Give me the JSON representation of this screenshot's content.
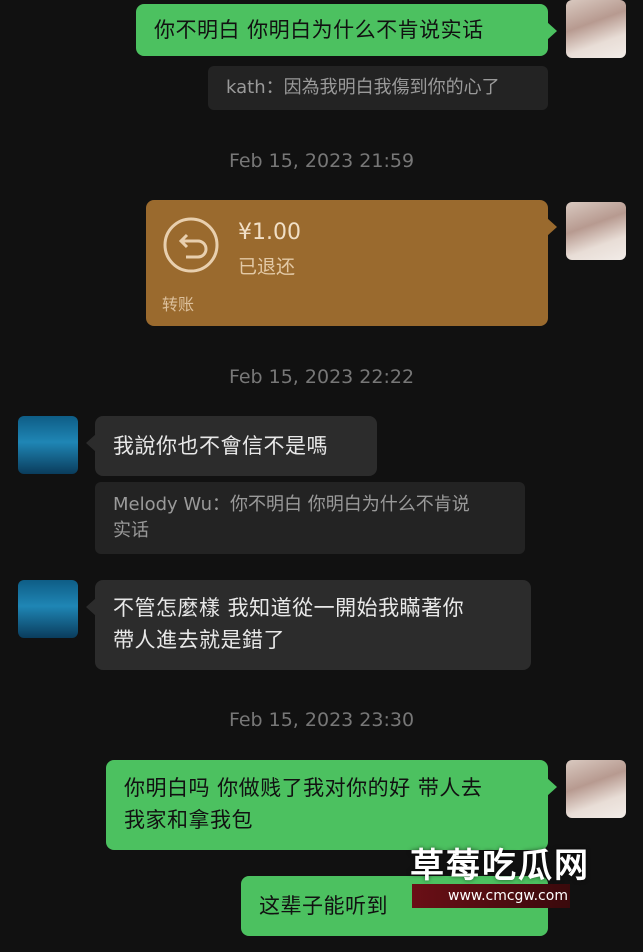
{
  "messages": {
    "m1": "你不明白 你明白为什么不肯说实话",
    "q1": "kath：因為我明白我傷到你的心了",
    "t1": "Feb 15, 2023 21:59",
    "transfer": {
      "amount": "¥1.00",
      "status": "已退还",
      "label": "转账"
    },
    "t2": "Feb 15, 2023 22:22",
    "m2": "我說你也不會信不是嗎",
    "q2_line1": "Melody Wu：你不明白 你明白为什么不肯说",
    "q2_line2": "实话",
    "m3_line1": "不管怎麼樣 我知道從一開始我瞞著你",
    "m3_line2": "帶人進去就是錯了",
    "t3": "Feb 15, 2023 23:30",
    "m4_line1": "你明白吗 你做贱了我对你的好 带人去",
    "m4_line2": "我家和拿我包",
    "m5": "这辈子能听到"
  },
  "watermark": {
    "title": "草莓吃瓜网",
    "url": "www.cmcgw.com"
  },
  "colors": {
    "background": "#111111",
    "green_bubble": "#4cc160",
    "gray_bubble": "#2c2c2c",
    "transfer": "#9a6a2e"
  }
}
